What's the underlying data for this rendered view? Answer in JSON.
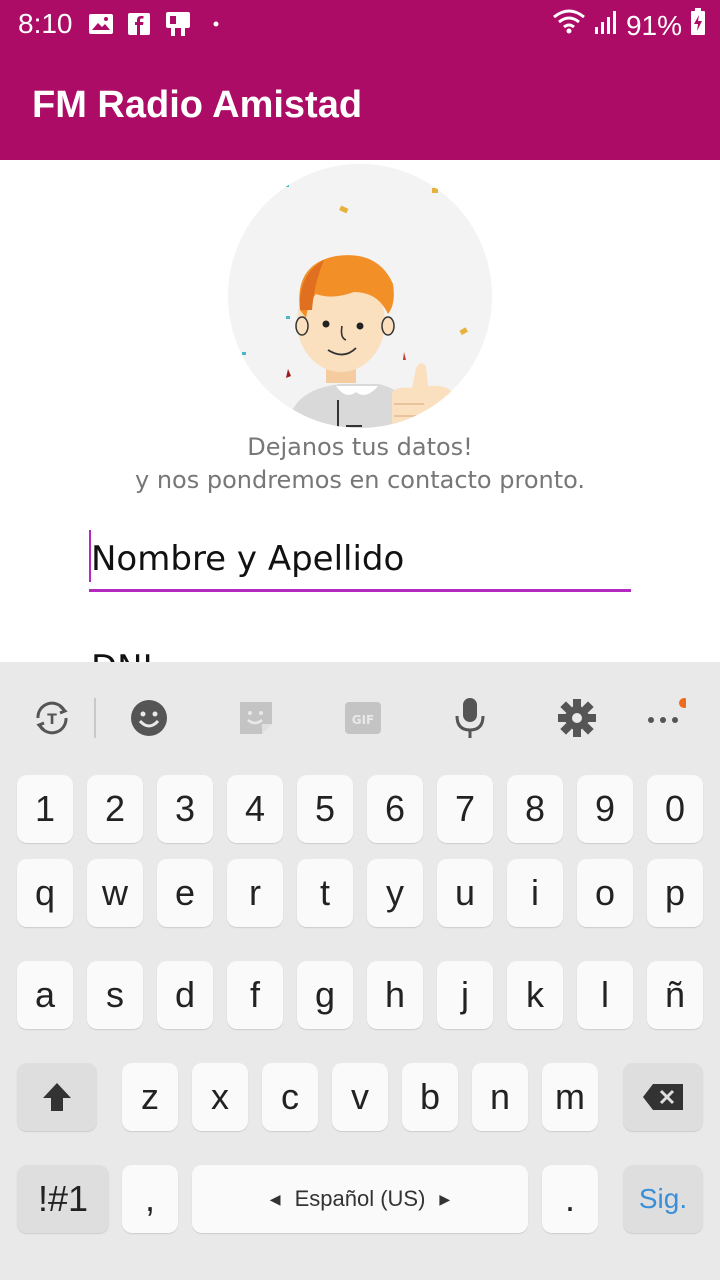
{
  "status": {
    "time": "8:10",
    "battery": "91%",
    "notification_icons": [
      "image-icon",
      "facebook-icon",
      "sim-icon",
      "dot-icon"
    ]
  },
  "app": {
    "title": "FM Radio Amistad"
  },
  "form": {
    "message_line1": "Dejanos tus datos!",
    "message_line2": "y nos pondremos en contacto pronto.",
    "name_placeholder": "Nombre y Apellido",
    "dni_placeholder": "DNI"
  },
  "keyboard": {
    "toolbar_icons": [
      "text-style-icon",
      "emoji-icon",
      "sticker-icon",
      "gif-icon",
      "microphone-icon",
      "settings-icon",
      "more-icon"
    ],
    "row_numbers": [
      "1",
      "2",
      "3",
      "4",
      "5",
      "6",
      "7",
      "8",
      "9",
      "0"
    ],
    "row1": [
      "q",
      "w",
      "e",
      "r",
      "t",
      "y",
      "u",
      "i",
      "o",
      "p"
    ],
    "row2": [
      "a",
      "s",
      "d",
      "f",
      "g",
      "h",
      "j",
      "k",
      "l",
      "ñ"
    ],
    "row3": [
      "z",
      "x",
      "c",
      "v",
      "b",
      "n",
      "m"
    ],
    "symbols_label": "!#1",
    "comma_label": ",",
    "space_label": "Español (US)",
    "period_label": ".",
    "action_label": "Sig."
  },
  "colors": {
    "primary": "#ad0c66",
    "accent": "#b42ac0",
    "action_text": "#3a8fd8"
  }
}
